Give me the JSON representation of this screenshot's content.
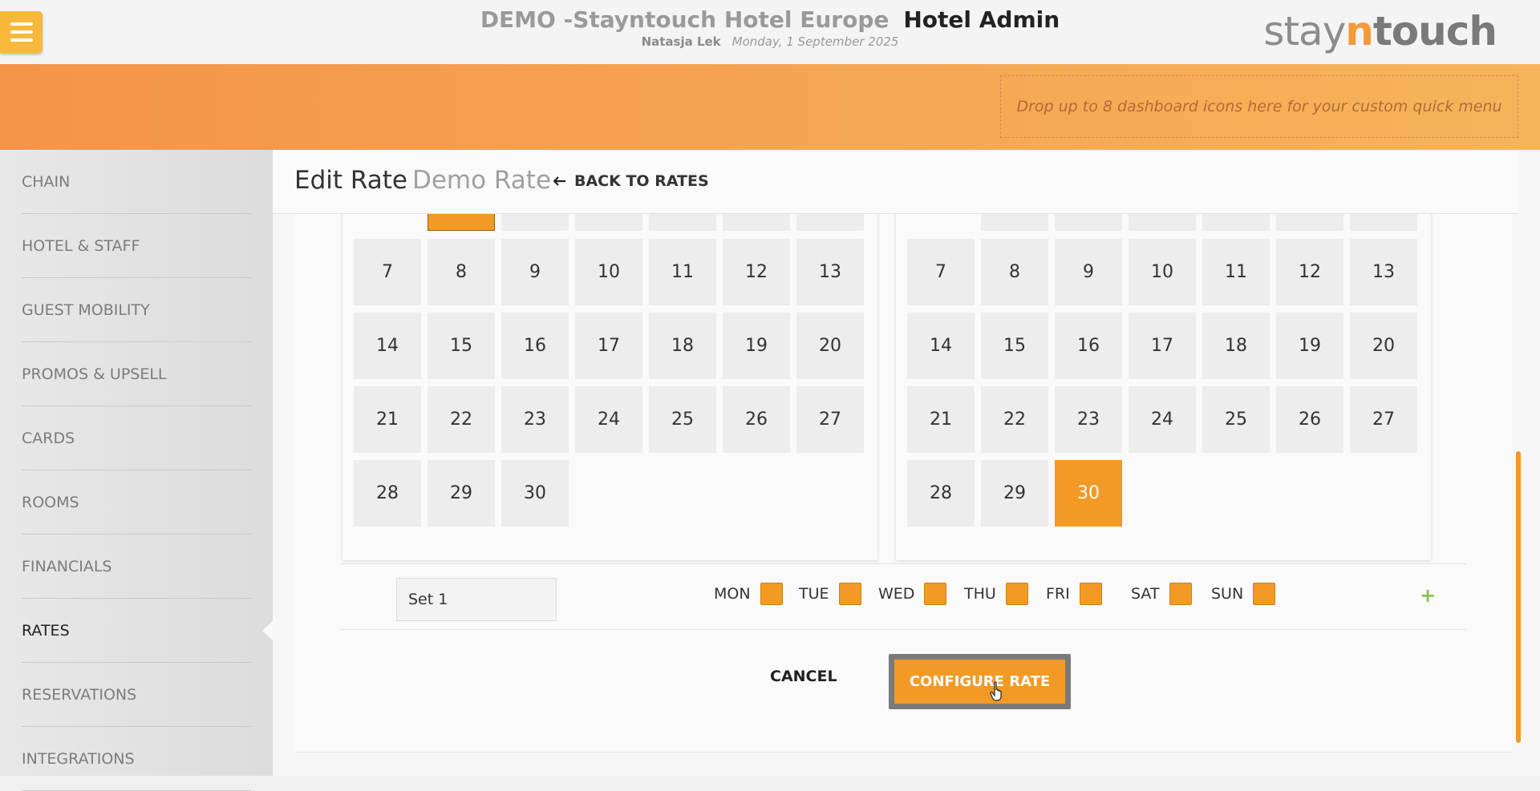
{
  "header": {
    "hotel_name": "DEMO -Stayntouch Hotel Europe",
    "app_name": "Hotel Admin",
    "user": "Natasja Lek",
    "date": "Monday, 1 September 2025",
    "logo": {
      "stay": "stay",
      "n": "n",
      "touch": "touch"
    },
    "menu_icon": "hamburger-icon"
  },
  "quick_menu": {
    "placeholder": "Drop up to 8 dashboard icons here for your custom quick menu"
  },
  "sidebar": {
    "items": [
      {
        "label": "CHAIN"
      },
      {
        "label": "HOTEL & STAFF"
      },
      {
        "label": "GUEST MOBILITY"
      },
      {
        "label": "PROMOS & UPSELL"
      },
      {
        "label": "CARDS"
      },
      {
        "label": "ROOMS"
      },
      {
        "label": "FINANCIALS"
      },
      {
        "label": "RATES",
        "active": true
      },
      {
        "label": "RESERVATIONS"
      },
      {
        "label": "INTEGRATIONS"
      }
    ]
  },
  "page": {
    "title": "Edit Rate",
    "subtitle": "Demo Rate",
    "back_label": "BACK TO RATES"
  },
  "calendar_left": {
    "rows": [
      [
        "7",
        "8",
        "9",
        "10",
        "11",
        "12",
        "13"
      ],
      [
        "14",
        "15",
        "16",
        "17",
        "18",
        "19",
        "20"
      ],
      [
        "21",
        "22",
        "23",
        "24",
        "25",
        "26",
        "27"
      ],
      [
        "28",
        "29",
        "30"
      ]
    ]
  },
  "calendar_right": {
    "rows": [
      [
        "7",
        "8",
        "9",
        "10",
        "11",
        "12",
        "13"
      ],
      [
        "14",
        "15",
        "16",
        "17",
        "18",
        "19",
        "20"
      ],
      [
        "21",
        "22",
        "23",
        "24",
        "25",
        "26",
        "27"
      ],
      [
        "28",
        "29",
        "30"
      ]
    ],
    "selected": "30"
  },
  "set": {
    "name": "Set 1",
    "days": [
      "MON",
      "TUE",
      "WED",
      "THU",
      "FRI",
      "SAT",
      "SUN"
    ]
  },
  "actions": {
    "cancel": "CANCEL",
    "configure": "CONFIGURE RATE",
    "add": "+"
  },
  "colors": {
    "accent": "#f29a25",
    "band_start": "#f4944b",
    "band_end": "#f6b45a",
    "add_green": "#8cc152"
  }
}
